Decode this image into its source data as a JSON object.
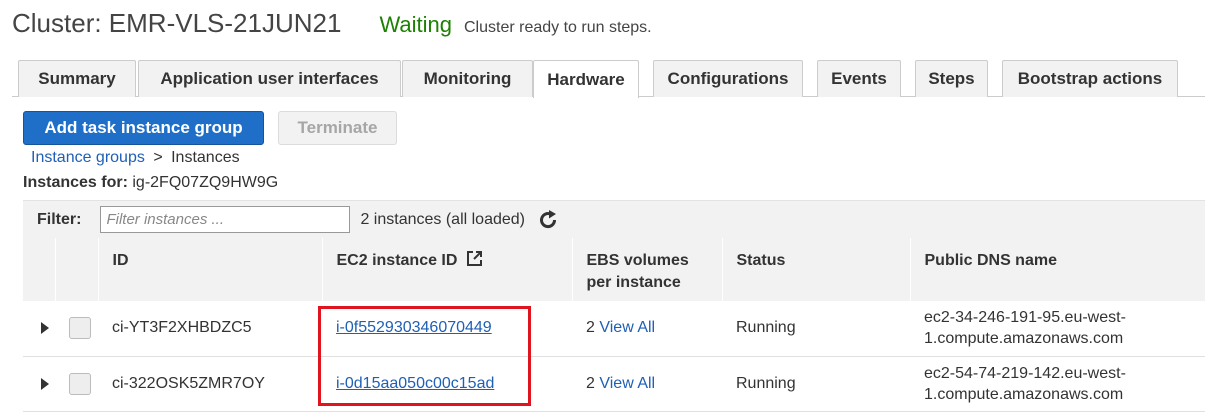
{
  "header": {
    "title": "Cluster: EMR-VLS-21JUN21",
    "status": "Waiting",
    "status_message": "Cluster ready to run steps."
  },
  "tabs": [
    {
      "label": "Summary"
    },
    {
      "label": "Application user interfaces"
    },
    {
      "label": "Monitoring"
    },
    {
      "label": "Hardware",
      "active": true
    },
    {
      "label": "Configurations"
    },
    {
      "label": "Events"
    },
    {
      "label": "Steps"
    },
    {
      "label": "Bootstrap actions"
    }
  ],
  "actions": {
    "add_task_label": "Add task instance group",
    "terminate_label": "Terminate"
  },
  "breadcrumb": {
    "parent": "Instance groups",
    "separator": ">",
    "current": "Instances"
  },
  "instances_for": {
    "label": "Instances for:",
    "group_id": "ig-2FQ07ZQ9HW9G"
  },
  "filter": {
    "label": "Filter:",
    "placeholder": "Filter instances ...",
    "count_text": "2 instances (all loaded)"
  },
  "table": {
    "headers": {
      "id": "ID",
      "ec2": "EC2 instance ID",
      "ebs_line1": "EBS volumes",
      "ebs_line2": "per instance",
      "status": "Status",
      "dns": "Public DNS name"
    },
    "rows": [
      {
        "id": "ci-YT3F2XHBDZC5",
        "ec2_id": "i-0f552930346070449",
        "ebs_count": "2",
        "ebs_link": "View All",
        "status": "Running",
        "dns_line1": "ec2-34-246-191-95.eu-west-",
        "dns_line2": "1.compute.amazonaws.com"
      },
      {
        "id": "ci-322OSK5ZMR7OY",
        "ec2_id": "i-0d15aa050c00c15ad",
        "ebs_count": "2",
        "ebs_link": "View All",
        "status": "Running",
        "dns_line1": "ec2-54-74-219-142.eu-west-",
        "dns_line2": "1.compute.amazonaws.com"
      }
    ]
  },
  "colors": {
    "accent": "#1f6fc9",
    "link": "#1f5fb5",
    "status_ok": "#1d8102",
    "highlight": "#e0141e"
  },
  "icons": {
    "refresh": "refresh-icon",
    "external_link": "external-link-icon",
    "expand": "caret-right-icon"
  }
}
